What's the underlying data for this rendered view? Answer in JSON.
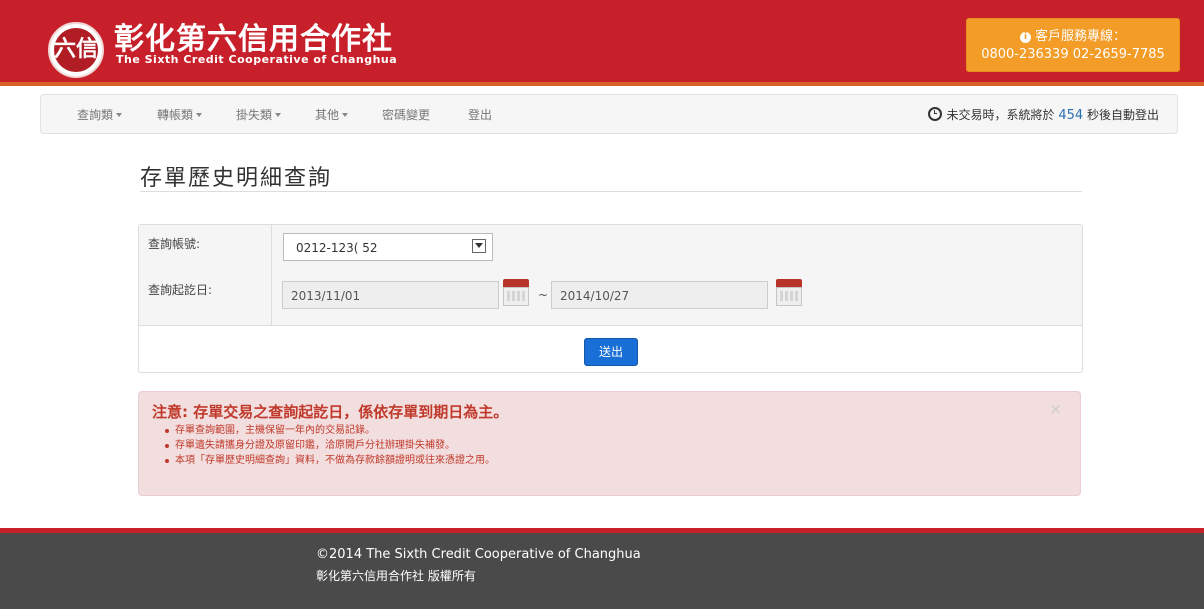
{
  "brand": {
    "title": "彰化第六信用合作社",
    "subtitle": "The Sixth Credit Cooperative of Changhua",
    "logo_text": "六信"
  },
  "hotline": {
    "label": "客戶服務專線：",
    "numbers": "0800-236339  02-2659-7785"
  },
  "nav": {
    "items": [
      {
        "label": "查詢類",
        "dropdown": true
      },
      {
        "label": "轉帳類",
        "dropdown": true
      },
      {
        "label": "掛失類",
        "dropdown": true
      },
      {
        "label": "其他",
        "dropdown": true
      },
      {
        "label": "密碼變更",
        "dropdown": false
      },
      {
        "label": "登出",
        "dropdown": false
      }
    ],
    "timeout_prefix": "未交易時，系統將於",
    "timeout_seconds": "454",
    "timeout_suffix": "秒後自動登出"
  },
  "page": {
    "title": "存單歷史明細查詢"
  },
  "form": {
    "account_label": "查詢帳號:",
    "account_value": "0212-123(    52",
    "date_label": "查詢起訖日:",
    "start_date": "2013/11/01",
    "range_separator": "~",
    "end_date": "2014/10/27",
    "submit_label": "送出"
  },
  "notice": {
    "title": "注意: 存單交易之查詢起訖日，係依存單到期日為主。",
    "items": [
      "存單查詢範圍，主機保留一年內的交易記錄。",
      "存單遺失請攜身分證及原留印鑑，洽原開戶分社辦理掛失補發。",
      "本項「存單歷史明細查詢」資料，不做為存款餘額證明或往來憑證之用。"
    ],
    "close_label": "×"
  },
  "footer": {
    "copyright": "©2014 The Sixth Credit Cooperative of Changhua",
    "rights": "彰化第六信用合作社 版權所有"
  },
  "colors": {
    "brand_red": "#c8202a",
    "hotline_orange": "#f39c27",
    "button_blue": "#1a6fd6",
    "alert_text": "#c0392b",
    "footer_bg": "#4a4a4a"
  }
}
